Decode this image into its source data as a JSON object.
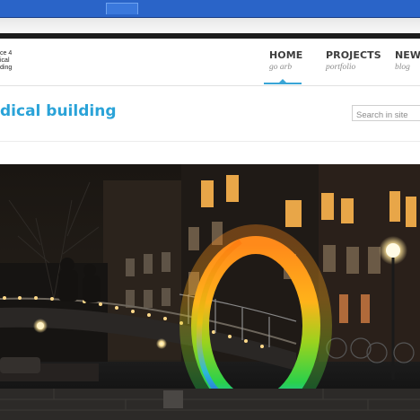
{
  "site": {
    "logo_lines": [
      "ce 4",
      "ical",
      "ding"
    ]
  },
  "nav": {
    "items": [
      {
        "label": "HOME",
        "sub": "go arb"
      },
      {
        "label": "PROJECTS",
        "sub": "portfolio"
      },
      {
        "label": "NEWS",
        "sub": "blog"
      }
    ],
    "active_index": 0
  },
  "page": {
    "title": "dical building"
  },
  "search": {
    "placeholder": "Search in site"
  },
  "colors": {
    "accent": "#2aa3d8",
    "nav_text": "#3d3d3d",
    "nav_sub": "#8d8d8d",
    "browser_chrome": "#2a64c8"
  },
  "hero": {
    "description_icon": "night-canal-photo"
  }
}
